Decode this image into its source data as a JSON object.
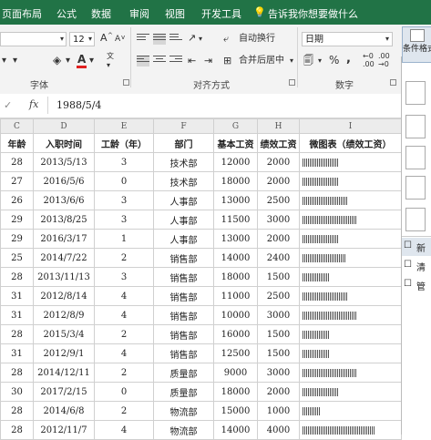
{
  "tabs": [
    "页面布局",
    "公式",
    "数据",
    "审阅",
    "视图",
    "开发工具"
  ],
  "tell_me": "告诉我你想要做什么",
  "ribbon": {
    "font_size": "12",
    "font_size_up": "A",
    "font_size_down": "A",
    "wen": "文",
    "fill_label": "A",
    "wrap_text": "自动换行",
    "merge_center": "合并后居中",
    "number_format": "日期",
    "percent": "%",
    "comma": ",",
    "cond_format": "条件格式",
    "groups": [
      "字体",
      "对齐方式",
      "数字"
    ]
  },
  "formula_bar": {
    "cancel": "✓",
    "fx": "fx",
    "value": "1988/5/4"
  },
  "columns": [
    "C",
    "D",
    "E",
    "F",
    "G",
    "H",
    "I"
  ],
  "headers": [
    "年龄",
    "入职时间",
    "工龄（年）",
    "部门",
    "基本工资",
    "绩效工资",
    "微图表（绩效工资）"
  ],
  "rows": [
    {
      "age": "28",
      "date": "2013/5/13",
      "years": "3",
      "dept": "技术部",
      "base": "12000",
      "perf": "2000",
      "spark": "||||||||||||||||||||"
    },
    {
      "age": "27",
      "date": "2016/5/6",
      "years": "0",
      "dept": "技术部",
      "base": "18000",
      "perf": "2000",
      "spark": "||||||||||||||||||||"
    },
    {
      "age": "26",
      "date": "2013/6/6",
      "years": "3",
      "dept": "人事部",
      "base": "13000",
      "perf": "2500",
      "spark": "|||||||||||||||||||||||||"
    },
    {
      "age": "29",
      "date": "2013/8/25",
      "years": "3",
      "dept": "人事部",
      "base": "11500",
      "perf": "3000",
      "spark": "||||||||||||||||||||||||||||||"
    },
    {
      "age": "29",
      "date": "2016/3/17",
      "years": "1",
      "dept": "人事部",
      "base": "13000",
      "perf": "2000",
      "spark": "||||||||||||||||||||"
    },
    {
      "age": "25",
      "date": "2014/7/22",
      "years": "2",
      "dept": "销售部",
      "base": "14000",
      "perf": "2400",
      "spark": "||||||||||||||||||||||||"
    },
    {
      "age": "28",
      "date": "2013/11/13",
      "years": "3",
      "dept": "销售部",
      "base": "18000",
      "perf": "1500",
      "spark": "|||||||||||||||"
    },
    {
      "age": "31",
      "date": "2012/8/14",
      "years": "4",
      "dept": "销售部",
      "base": "11000",
      "perf": "2500",
      "spark": "|||||||||||||||||||||||||"
    },
    {
      "age": "31",
      "date": "2012/8/9",
      "years": "4",
      "dept": "销售部",
      "base": "10000",
      "perf": "3000",
      "spark": "||||||||||||||||||||||||||||||"
    },
    {
      "age": "28",
      "date": "2015/3/4",
      "years": "2",
      "dept": "销售部",
      "base": "16000",
      "perf": "1500",
      "spark": "|||||||||||||||"
    },
    {
      "age": "31",
      "date": "2012/9/1",
      "years": "4",
      "dept": "销售部",
      "base": "12500",
      "perf": "1500",
      "spark": "|||||||||||||||"
    },
    {
      "age": "28",
      "date": "2014/12/11",
      "years": "2",
      "dept": "质量部",
      "base": "9000",
      "perf": "3000",
      "spark": "||||||||||||||||||||||||||||||"
    },
    {
      "age": "30",
      "date": "2017/2/15",
      "years": "0",
      "dept": "质量部",
      "base": "18000",
      "perf": "2000",
      "spark": "||||||||||||||||||||"
    },
    {
      "age": "28",
      "date": "2014/6/8",
      "years": "2",
      "dept": "物流部",
      "base": "15000",
      "perf": "1000",
      "spark": "||||||||||"
    },
    {
      "age": "28",
      "date": "2012/11/7",
      "years": "4",
      "dept": "物流部",
      "base": "14000",
      "perf": "4000",
      "spark": "||||||||||||||||||||||||||||||||||||||||"
    }
  ],
  "cf_menu": {
    "new_rule": "新",
    "clear": "清",
    "manage": "管"
  }
}
